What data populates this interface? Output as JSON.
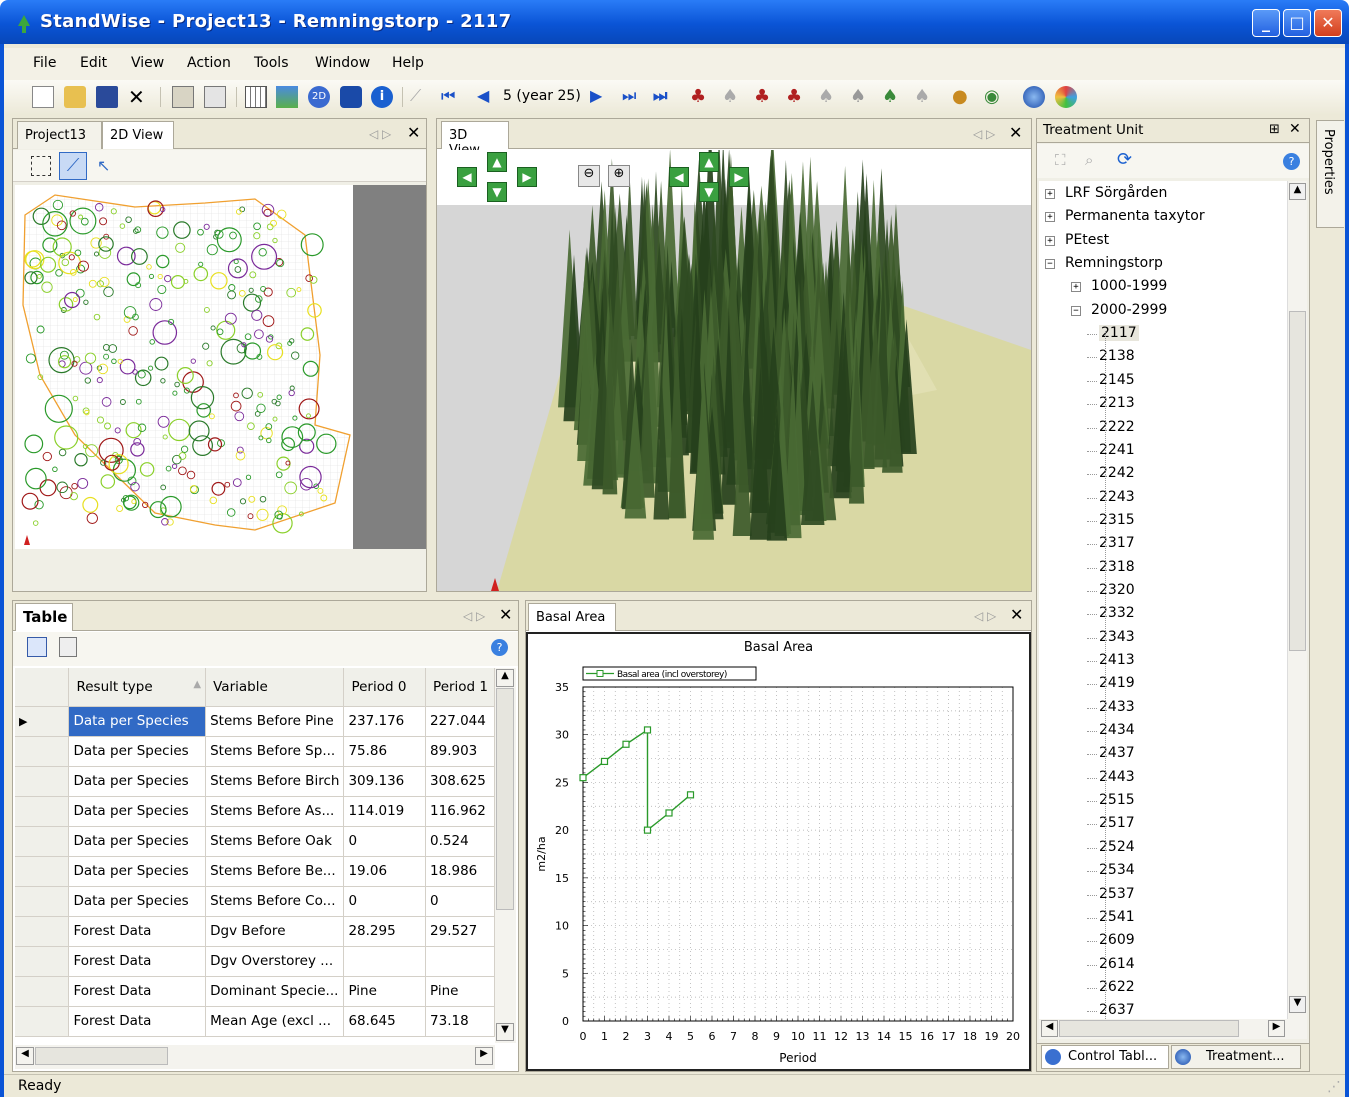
{
  "window": {
    "title": "StandWise - Project13 - Remningstorp - 2117"
  },
  "menu": [
    "File",
    "Edit",
    "View",
    "Action",
    "Tools",
    "Window",
    "Help"
  ],
  "toolbar": {
    "period": "5 (year 25)"
  },
  "left_panel": {
    "tabs": [
      "Project13",
      "2D View"
    ]
  },
  "view3d": {
    "tab": "3D View"
  },
  "treatment": {
    "title": "Treatment Unit",
    "side_tab": "Properties",
    "items": [
      {
        "label": "LRF Sörgården",
        "level": 0,
        "exp": "+"
      },
      {
        "label": "Permanenta taxytor",
        "level": 0,
        "exp": "+"
      },
      {
        "label": "PEtest",
        "level": 0,
        "exp": "+"
      },
      {
        "label": "Remningstorp",
        "level": 0,
        "exp": "−"
      },
      {
        "label": "1000-1999",
        "level": 1,
        "exp": "+"
      },
      {
        "label": "2000-2999",
        "level": 1,
        "exp": "−"
      },
      {
        "label": "2117",
        "level": 2,
        "sel": true
      },
      {
        "label": "2138",
        "level": 2
      },
      {
        "label": "2145",
        "level": 2
      },
      {
        "label": "2213",
        "level": 2
      },
      {
        "label": "2222",
        "level": 2
      },
      {
        "label": "2241",
        "level": 2
      },
      {
        "label": "2242",
        "level": 2
      },
      {
        "label": "2243",
        "level": 2
      },
      {
        "label": "2315",
        "level": 2
      },
      {
        "label": "2317",
        "level": 2
      },
      {
        "label": "2318",
        "level": 2
      },
      {
        "label": "2320",
        "level": 2
      },
      {
        "label": "2332",
        "level": 2
      },
      {
        "label": "2343",
        "level": 2
      },
      {
        "label": "2413",
        "level": 2
      },
      {
        "label": "2419",
        "level": 2
      },
      {
        "label": "2433",
        "level": 2
      },
      {
        "label": "2434",
        "level": 2
      },
      {
        "label": "2437",
        "level": 2
      },
      {
        "label": "2443",
        "level": 2
      },
      {
        "label": "2515",
        "level": 2
      },
      {
        "label": "2517",
        "level": 2
      },
      {
        "label": "2524",
        "level": 2
      },
      {
        "label": "2534",
        "level": 2
      },
      {
        "label": "2537",
        "level": 2
      },
      {
        "label": "2541",
        "level": 2
      },
      {
        "label": "2609",
        "level": 2
      },
      {
        "label": "2614",
        "level": 2
      },
      {
        "label": "2622",
        "level": 2
      },
      {
        "label": "2637",
        "level": 2
      }
    ],
    "bottom_tabs": [
      "Control Tabl...",
      "Treatment..."
    ]
  },
  "table": {
    "title": "Table",
    "columns": [
      "Result type",
      "Variable",
      "Period 0",
      "Period 1"
    ],
    "rows": [
      [
        "Data per Species",
        "Stems Before Pine",
        "237.176",
        "227.044"
      ],
      [
        "Data per Species",
        "Stems Before Sp...",
        "75.86",
        "89.903"
      ],
      [
        "Data per Species",
        "Stems Before Birch",
        "309.136",
        "308.625"
      ],
      [
        "Data per Species",
        "Stems Before As...",
        "114.019",
        "116.962"
      ],
      [
        "Data per Species",
        "Stems Before Oak",
        "0",
        "0.524"
      ],
      [
        "Data per Species",
        "Stems Before Be...",
        "19.06",
        "18.986"
      ],
      [
        "Data per Species",
        "Stems Before Co...",
        "0",
        "0"
      ],
      [
        "Forest Data",
        "Dgv Before",
        "28.295",
        "29.527"
      ],
      [
        "Forest Data",
        "Dgv Overstorey ...",
        "",
        ""
      ],
      [
        "Forest Data",
        "Dominant Specie...",
        "Pine",
        "Pine"
      ],
      [
        "Forest Data",
        "Mean Age (excl ...",
        "68.645",
        "73.18"
      ]
    ]
  },
  "basal": {
    "tab": "Basal Area"
  },
  "chart_data": {
    "type": "line",
    "title": "Basal Area",
    "xlabel": "Period",
    "ylabel": "m2/ha",
    "xlim": [
      0,
      20
    ],
    "ylim": [
      0,
      35
    ],
    "xticks": [
      0,
      1,
      2,
      3,
      4,
      5,
      6,
      7,
      8,
      9,
      10,
      11,
      12,
      13,
      14,
      15,
      16,
      17,
      18,
      19,
      20
    ],
    "yticks": [
      0,
      5,
      10,
      15,
      20,
      25,
      30,
      35
    ],
    "grid": true,
    "legend": "top-left",
    "series": [
      {
        "name": "Basal area (incl overstorey)",
        "color": "#2a9a2a",
        "x": [
          0,
          1,
          2,
          3,
          3,
          4,
          5
        ],
        "y": [
          25.5,
          27.2,
          29.0,
          30.5,
          20.0,
          21.8,
          23.7
        ]
      }
    ]
  },
  "status": {
    "text": "Ready"
  }
}
